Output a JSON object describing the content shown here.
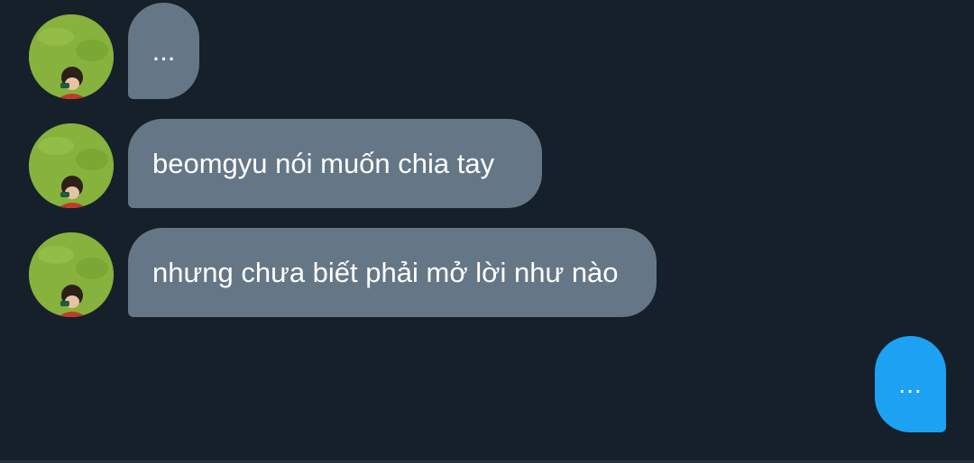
{
  "conversation": {
    "messages": [
      {
        "sender": "other",
        "text": "..."
      },
      {
        "sender": "other",
        "text": "beomgyu nói muốn chia tay"
      },
      {
        "sender": "other",
        "text": "nhưng chưa biết phải mở lời như nào"
      }
    ],
    "typing_indicator": {
      "sender": "self",
      "text": "..."
    }
  },
  "colors": {
    "background": "#16202b",
    "incoming_bubble": "#657786",
    "outgoing_bubble": "#1da1f2",
    "text": "#ffffff"
  },
  "icons": {
    "avatar": "user-photo-avatar"
  }
}
